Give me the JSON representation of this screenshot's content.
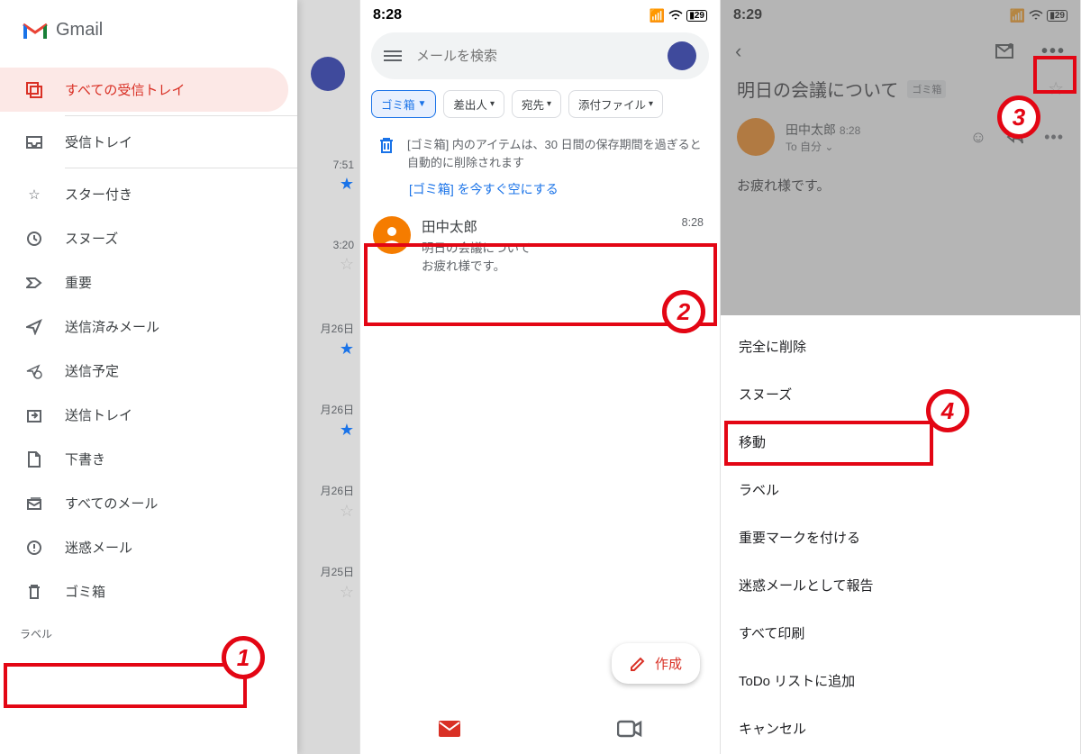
{
  "panel1": {
    "brand": "Gmail",
    "nav": [
      {
        "label": "すべての受信トレイ",
        "active": true
      },
      {
        "label": "受信トレイ"
      },
      {
        "label": "スター付き"
      },
      {
        "label": "スヌーズ"
      },
      {
        "label": "重要"
      },
      {
        "label": "送信済みメール"
      },
      {
        "label": "送信予定"
      },
      {
        "label": "送信トレイ"
      },
      {
        "label": "下書き"
      },
      {
        "label": "すべてのメール"
      },
      {
        "label": "迷惑メール"
      },
      {
        "label": "ゴミ箱"
      }
    ],
    "label_header": "ラベル",
    "behind_times": [
      "7:51",
      "3:20",
      "月26日",
      "月26日",
      "月26日",
      "月25日"
    ]
  },
  "panel2": {
    "time": "8:28",
    "battery": "29",
    "search_placeholder": "メールを検索",
    "chips": [
      "ゴミ箱",
      "差出人",
      "宛先",
      "添付ファイル"
    ],
    "trash_note": "[ゴミ箱] 内のアイテムは、30 日間の保存期間を過ぎると自動的に削除されます",
    "empty_link": "[ゴミ箱] を今すぐ空にする",
    "mail": {
      "sender": "田中太郎",
      "time": "8:28",
      "subject": "明日の会議について",
      "preview": "お疲れ様です。"
    },
    "compose": "作成"
  },
  "panel3": {
    "time": "8:29",
    "battery": "29",
    "subject": "明日の会議について",
    "tag": "ゴミ箱",
    "sender": "田中太郎",
    "sent_time": "8:28",
    "to": "To 自分",
    "body": "お疲れ様です。",
    "sheet": [
      "完全に削除",
      "スヌーズ",
      "移動",
      "ラベル",
      "重要マークを付ける",
      "迷惑メールとして報告",
      "すべて印刷",
      "ToDo リストに追加",
      "キャンセル"
    ]
  },
  "annotations": {
    "n1": "1",
    "n2": "2",
    "n3": "3",
    "n4": "4"
  }
}
